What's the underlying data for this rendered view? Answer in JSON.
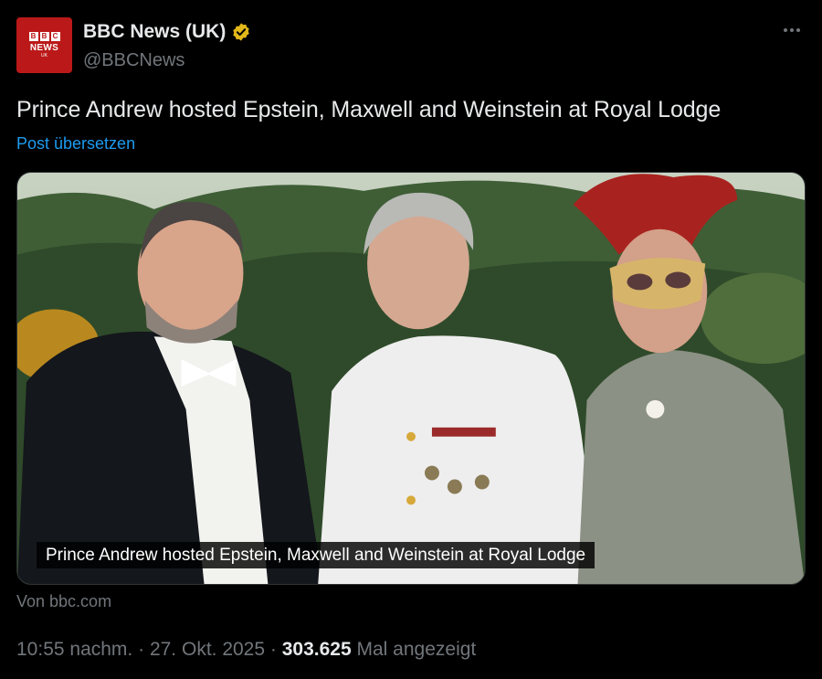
{
  "author": {
    "avatar": {
      "blocks": [
        "B",
        "B",
        "C"
      ],
      "line1": "NEWS",
      "line2": "UK"
    },
    "display_name": "BBC News (UK)",
    "handle": "@BBCNews",
    "verified_color": "#e2b719"
  },
  "post": {
    "text": "Prince Andrew hosted Epstein, Maxwell and Weinstein at Royal Lodge",
    "translate_label": "Post übersetzen"
  },
  "media": {
    "caption": "Prince Andrew hosted Epstein, Maxwell and Weinstein at Royal Lodge"
  },
  "card_source": "Von bbc.com",
  "meta": {
    "time": "10:55 nachm.",
    "separator": "·",
    "date": "27. Okt. 2025",
    "views": "303.625",
    "views_label": "Mal angezeigt"
  },
  "colors": {
    "link": "#1d9bf0",
    "muted": "#71767b",
    "brand_red": "#bb1919"
  }
}
